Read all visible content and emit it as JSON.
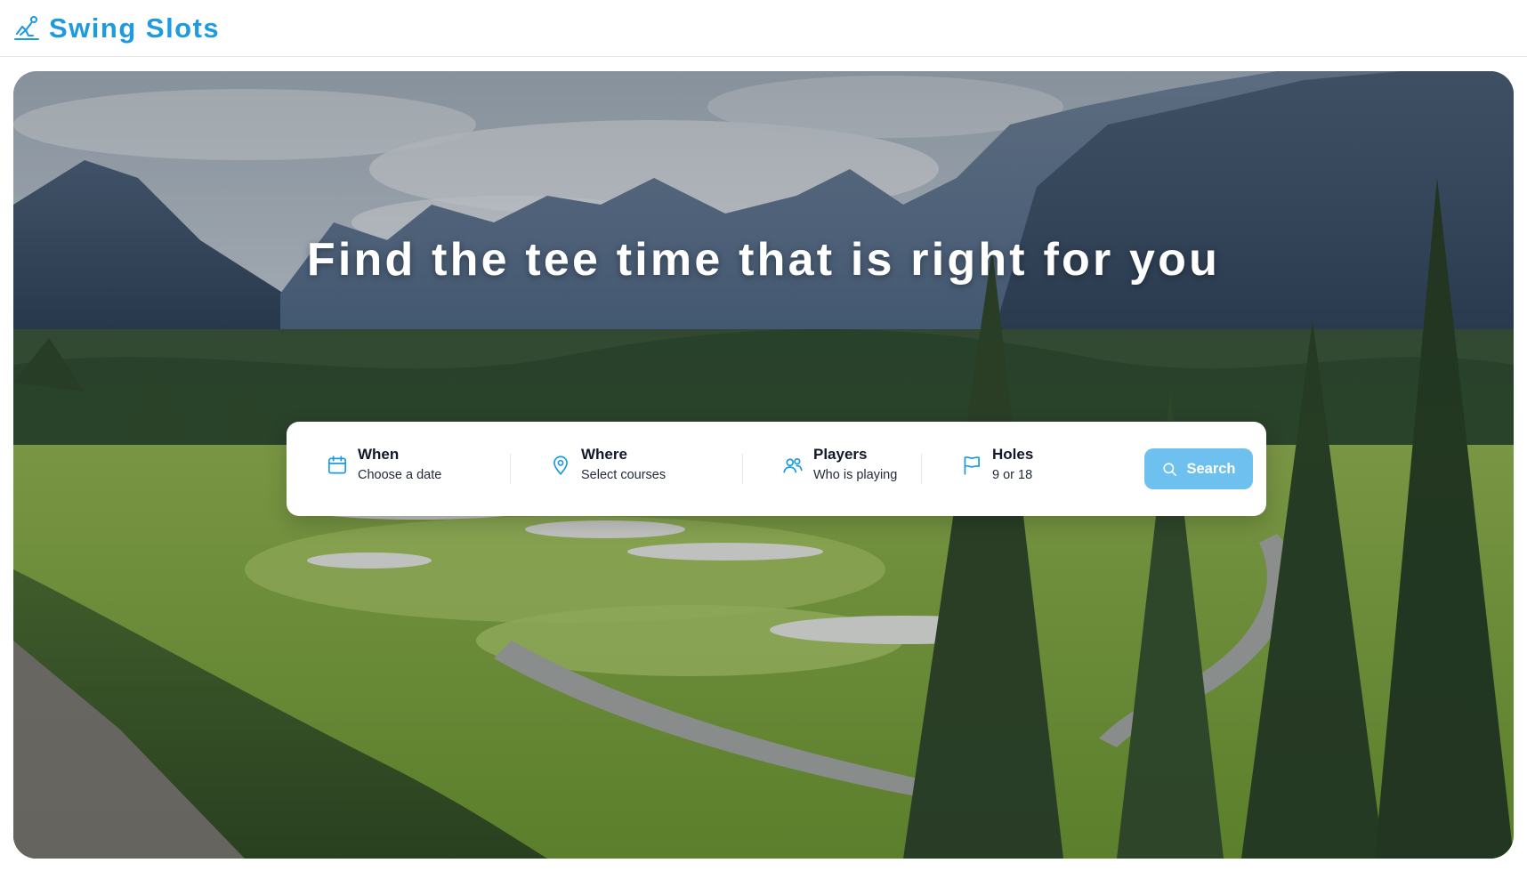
{
  "brand": {
    "name": "Swing Slots",
    "icon": "golfer-swing-icon",
    "color": "#1e9be0"
  },
  "hero": {
    "headline": "Find the tee time that is right for you",
    "background": "golf-course-mountain-landscape"
  },
  "search": {
    "fields": [
      {
        "label": "When",
        "value": "Choose a date",
        "icon": "calendar-icon"
      },
      {
        "label": "Where",
        "value": "Select courses",
        "icon": "map-pin-icon"
      },
      {
        "label": "Players",
        "value": "Who is playing",
        "icon": "users-icon"
      },
      {
        "label": "Holes",
        "value": "9 or 18",
        "icon": "flag-icon"
      }
    ],
    "button_label": "Search",
    "button_icon": "search-icon",
    "accent": "#6ec1ef",
    "icon_color": "#1e9be0"
  }
}
